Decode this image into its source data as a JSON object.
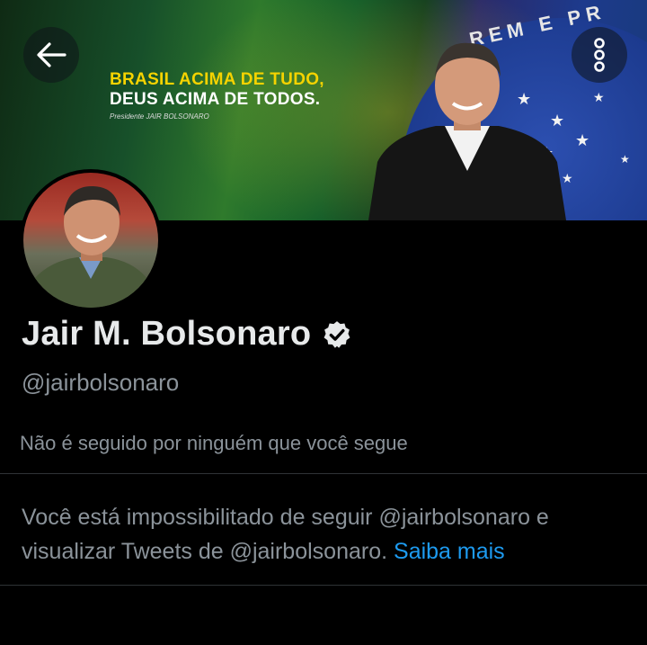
{
  "header": {
    "back_icon": "arrow-left-icon",
    "more_icon": "more-vertical-icon"
  },
  "banner": {
    "slogan_line1": "BRASIL ACIMA DE TUDO,",
    "slogan_line2": "DEUS ACIMA DE TODOS.",
    "signature": "Presidente JAIR BOLSONARO",
    "flag_motto": "REM E PR"
  },
  "profile": {
    "name": "Jair M. Bolsonaro",
    "verified_icon": "verified-badge-icon",
    "handle": "@jairbolsonaro",
    "followed_by": "Não é seguido por ninguém que você segue",
    "notice_text": "Você está impossibilitado de seguir @jairbolsonaro e visualizar Tweets de @jairbolsonaro.",
    "notice_link": "Saiba mais"
  },
  "colors": {
    "background": "#000000",
    "text_primary": "#e7e9ea",
    "text_secondary": "#8b939a",
    "link": "#1d9bf0",
    "divider": "#2f3336",
    "slogan_yellow": "#f5d300"
  }
}
